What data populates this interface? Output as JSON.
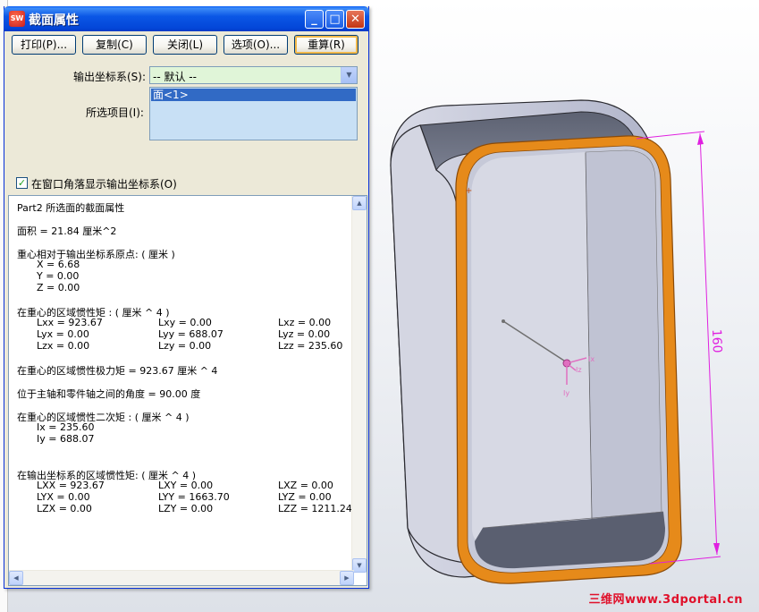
{
  "dialog": {
    "title": "截面属性",
    "app_icon_text": "SW",
    "buttons": {
      "print": "打印(P)...",
      "copy": "复制(C)",
      "close": "关闭(L)",
      "options": "选项(O)...",
      "recalc": "重算(R)"
    },
    "output_coord_label": "输出坐标系(S):",
    "output_coord_value": "-- 默认 --",
    "selected_items_label": "所选项目(I):",
    "selected_items": [
      "面<1>"
    ],
    "show_coord_checkbox": {
      "label": "在窗口角落显示输出坐标系(O)",
      "checked": true
    }
  },
  "results": {
    "header": "Part2 所选面的截面属性",
    "area": "面积 = 21.84 厘米^2",
    "centroid_title": "重心相对于输出坐标系原点: ( 厘米 )",
    "centroid": [
      "X = 6.68",
      "Y = 0.00",
      "Z = 0.00"
    ],
    "moi_centroid_title": "在重心的区域惯性矩 : ( 厘米 ^ 4 )",
    "moi_centroid": [
      [
        "Lxx = 923.67",
        "Lxy = 0.00",
        "Lxz = 0.00"
      ],
      [
        "Lyx = 0.00",
        "Lyy = 688.07",
        "Lyz = 0.00"
      ],
      [
        "Lzx = 0.00",
        "Lzy = 0.00",
        "Lzz = 235.60"
      ]
    ],
    "polar_moment": "在重心的区域惯性极力矩 = 923.67 厘米 ^ 4",
    "principal_angle": "位于主轴和零件轴之间的角度 = 90.00 度",
    "second_moment_title": "在重心的区域惯性二次矩 : ( 厘米 ^ 4 )",
    "second_moment": [
      "Ix = 235.60",
      "Iy = 688.07"
    ],
    "moi_output_title": "在输出坐标系的区域惯性矩: ( 厘米 ^ 4 )",
    "moi_output": [
      [
        "LXX = 923.67",
        "LXY = 0.00",
        "LXZ = 0.00"
      ],
      [
        "LYX = 0.00",
        "LYY = 1663.70",
        "LYZ = 0.00"
      ],
      [
        "LZX = 0.00",
        "LZY = 0.00",
        "LZZ = 1211.24"
      ]
    ]
  },
  "viewport": {
    "dimension": "160",
    "axis_labels": [
      "Ix",
      "Iy",
      "Iz"
    ],
    "watermark": "三维网www.3dportal.cn",
    "colors": {
      "face_highlight": "#e68a1a",
      "dimension": "#e020e0",
      "body": "#b9bdd0",
      "watermark": "#e0102a"
    }
  }
}
